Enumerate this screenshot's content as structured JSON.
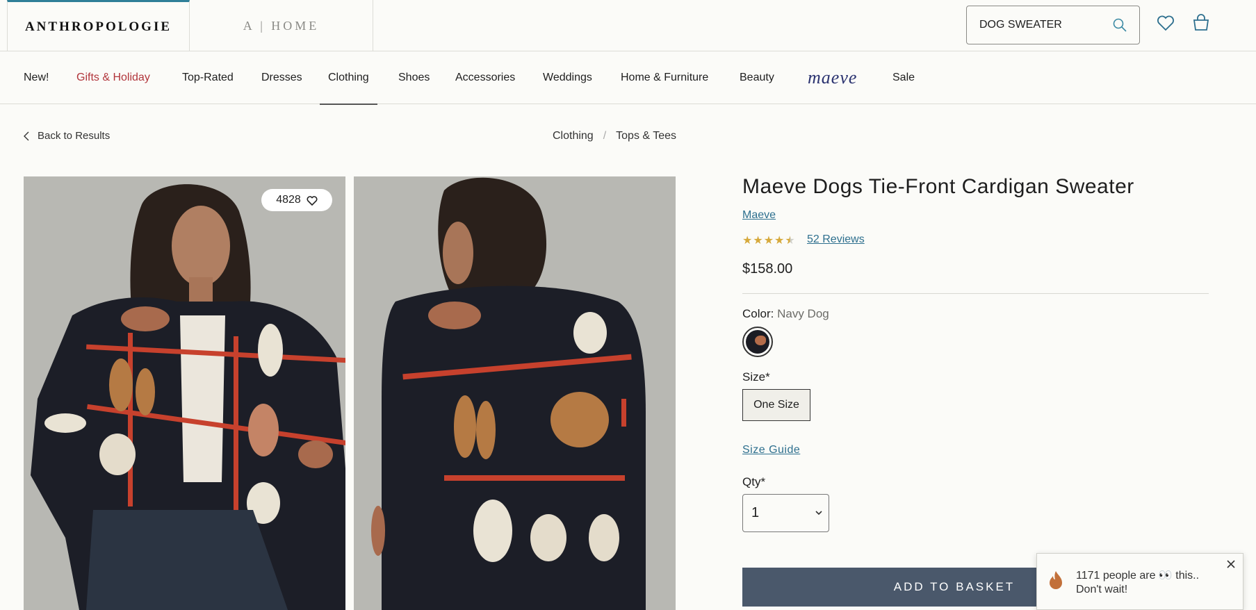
{
  "header": {
    "brand_main": "ANTHROPOLOGIE",
    "brand_home": "A | HOME",
    "search_value": "DOG SWEATER"
  },
  "nav": {
    "items": [
      "New!",
      "Gifts & Holiday",
      "Top-Rated",
      "Dresses",
      "Clothing",
      "Shoes",
      "Accessories",
      "Weddings",
      "Home & Furniture",
      "Beauty",
      "maeve",
      "Sale"
    ],
    "active": "Clothing"
  },
  "subnav": {
    "back": "Back to Results",
    "breadcrumb": [
      "Clothing",
      "Tops & Tees"
    ],
    "breadcrumb_sep": "/"
  },
  "gallery": {
    "like_count": "4828"
  },
  "product": {
    "title": "Maeve Dogs Tie-Front Cardigan Sweater",
    "brand": "Maeve",
    "rating": 4.5,
    "reviews": "52 Reviews",
    "price": "$158.00",
    "color_label": "Color:",
    "color_value": "Navy Dog",
    "size_label": "Size*",
    "size_option": "One Size",
    "size_guide": "Size Guide",
    "qty_label": "Qty*",
    "qty_value": "1",
    "add_to_basket": "ADD TO BASKET"
  },
  "popup": {
    "line1": "1171 people are 👀 this..",
    "line2": "Don't wait!"
  },
  "colors": {
    "accent_link": "#2d6f8e",
    "sale_red": "#b1353b",
    "basket_button": "#4a586b",
    "star_gold": "#d6a93b"
  }
}
